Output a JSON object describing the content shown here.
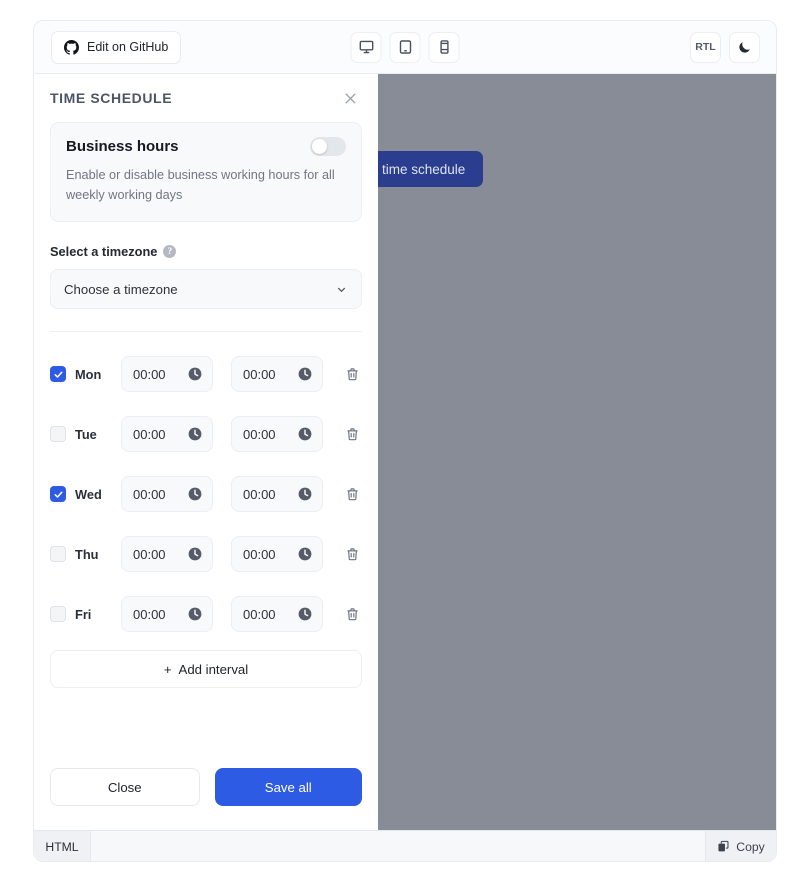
{
  "toolbar": {
    "github_label": "Edit on GitHub",
    "github_icon": "github-icon",
    "devices": [
      {
        "name": "desktop-view-button",
        "icon": "desktop-icon"
      },
      {
        "name": "tablet-view-button",
        "icon": "tablet-icon"
      },
      {
        "name": "mobile-view-button",
        "icon": "mobile-icon"
      }
    ],
    "rtl_label": "RTL",
    "theme_icon": "moon-icon"
  },
  "preview": {
    "background_button_label": "time schedule",
    "backdrop_color": "#878c96"
  },
  "panel": {
    "title": "TIME SCHEDULE",
    "close_icon": "close-icon",
    "business_hours": {
      "title": "Business hours",
      "description": "Enable or disable business working hours for all weekly working days",
      "toggle_state": "off"
    },
    "timezone": {
      "label": "Select a timezone",
      "help_icon": "help-icon",
      "placeholder": "Choose a timezone",
      "value": "Choose a timezone",
      "chevron_icon": "chevron-down-icon"
    },
    "days": [
      {
        "label": "Mon",
        "checked": true,
        "start": "00:00",
        "end": "00:00"
      },
      {
        "label": "Tue",
        "checked": false,
        "start": "00:00",
        "end": "00:00"
      },
      {
        "label": "Wed",
        "checked": true,
        "start": "00:00",
        "end": "00:00"
      },
      {
        "label": "Thu",
        "checked": false,
        "start": "00:00",
        "end": "00:00"
      },
      {
        "label": "Fri",
        "checked": false,
        "start": "00:00",
        "end": "00:00"
      }
    ],
    "add_interval_label": "Add interval",
    "add_interval_plus": "+",
    "close_label": "Close",
    "save_label": "Save all",
    "accent_color": "#2d5be3"
  },
  "code_bar": {
    "tab_label": "HTML",
    "copy_label": "Copy",
    "copy_icon": "copy-icon"
  }
}
